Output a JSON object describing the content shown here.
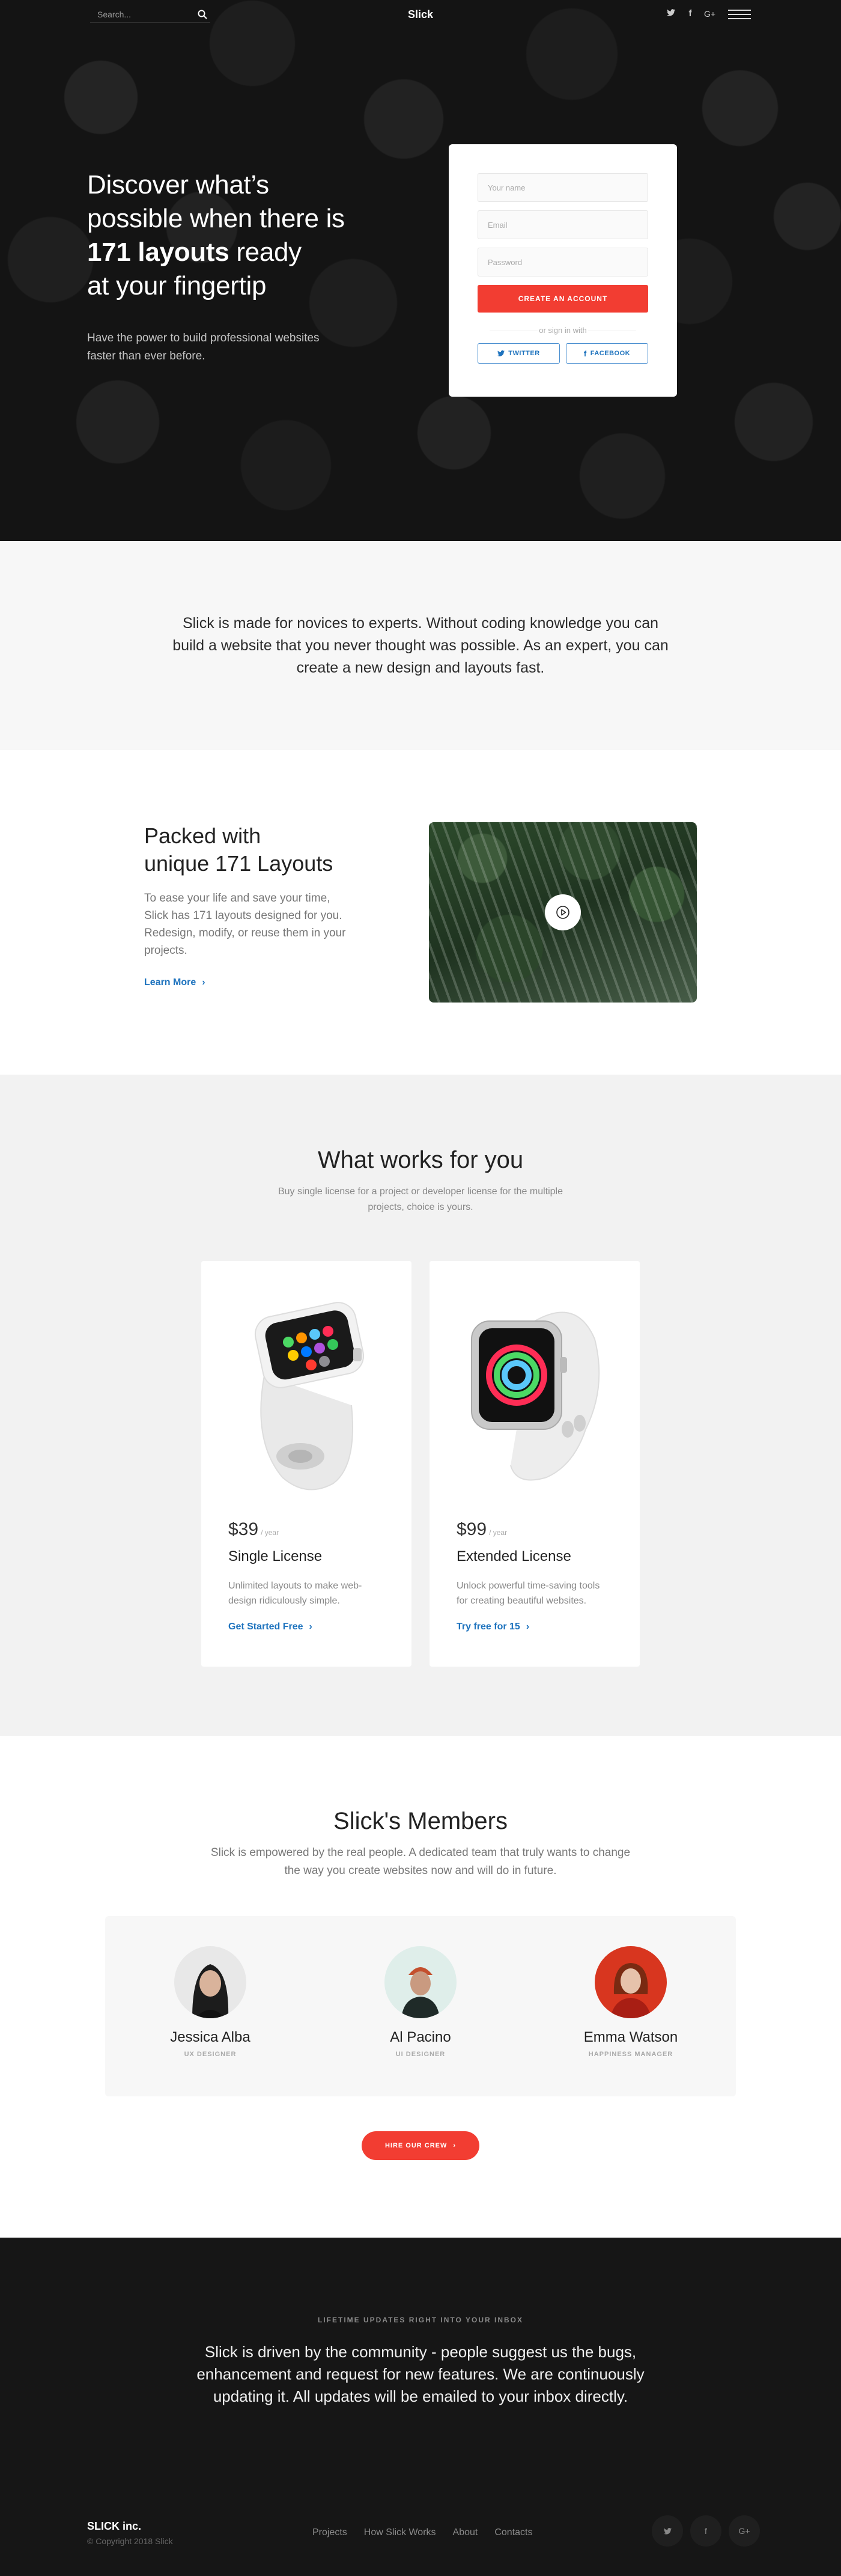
{
  "topbar": {
    "search_placeholder": "Search...",
    "brand": "Slick",
    "icons": [
      "twitter-icon",
      "facebook-icon",
      "google-plus-icon",
      "menu-icon"
    ]
  },
  "hero": {
    "headline_1": "Discover what’s",
    "headline_2": "possible when there is",
    "headline_bold": "171 layouts",
    "headline_3": " ready",
    "headline_4": "at your fingertip",
    "subtitle": "Have the power to build professional websites faster than ever before."
  },
  "signup": {
    "name_placeholder": "Your name",
    "email_placeholder": "Email",
    "password_placeholder": "Password",
    "create_label": "CREATE AN ACCOUNT",
    "or_label": "or sign in with",
    "twitter_label": "TWITTER",
    "facebook_label": "FACEBOOK"
  },
  "intro": {
    "text": "Slick is made for novices to experts. Without coding knowledge you can build a website that you never thought was possible. As an expert, you can create a new design and layouts fast."
  },
  "feature": {
    "title_1": "Packed with",
    "title_2": "unique 171 Layouts",
    "text": "To ease your life and save your time, Slick has 171 layouts designed for you. Redesign, modify, or reuse them in your projects.",
    "link": "Learn More"
  },
  "pricing": {
    "title": "What works for you",
    "subtitle": "Buy single license for a project or developer license for the multiple projects, choice is yours.",
    "plans": [
      {
        "price": "$39",
        "period": "/ year",
        "name": "Single License",
        "desc": "Unlimited layouts to make web-design ridiculously simple.",
        "cta": "Get Started Free"
      },
      {
        "price": "$99",
        "period": "/ year",
        "name": "Extended License",
        "desc": "Unlock powerful time-saving tools for creating beautiful websites.",
        "cta": "Try free for 15"
      }
    ]
  },
  "members": {
    "title": "Slick's Members",
    "subtitle": "Slick is empowered by the real people. A dedicated team that truly wants to change the way you create websites now and will do in future.",
    "people": [
      {
        "name": "Jessica Alba",
        "role": "UX DESIGNER"
      },
      {
        "name": "Al Pacino",
        "role": "UI DESIGNER"
      },
      {
        "name": "Emma Watson",
        "role": "HAPPINESS MANAGER"
      }
    ],
    "hire_label": "HIRE OUR CREW"
  },
  "footer": {
    "kicker": "LIFETIME UPDATES RIGHT INTO YOUR INBOX",
    "message": "Slick is driven by the community - people suggest us the bugs, enhancement and request for new features. We are continuously updating it. All updates will be emailed to your inbox directly.",
    "brand": "SLICK inc.",
    "copyright": "© Copyright 2018 Slick",
    "links": [
      "Projects",
      "How Slick Works",
      "About",
      "Contacts"
    ],
    "social_glyphs": [
      "t",
      "f",
      "G+"
    ]
  },
  "colors": {
    "accent": "#f23d32",
    "link": "#1e73be",
    "footer_bg": "#161616",
    "section_gray": "#f2f2f2"
  }
}
